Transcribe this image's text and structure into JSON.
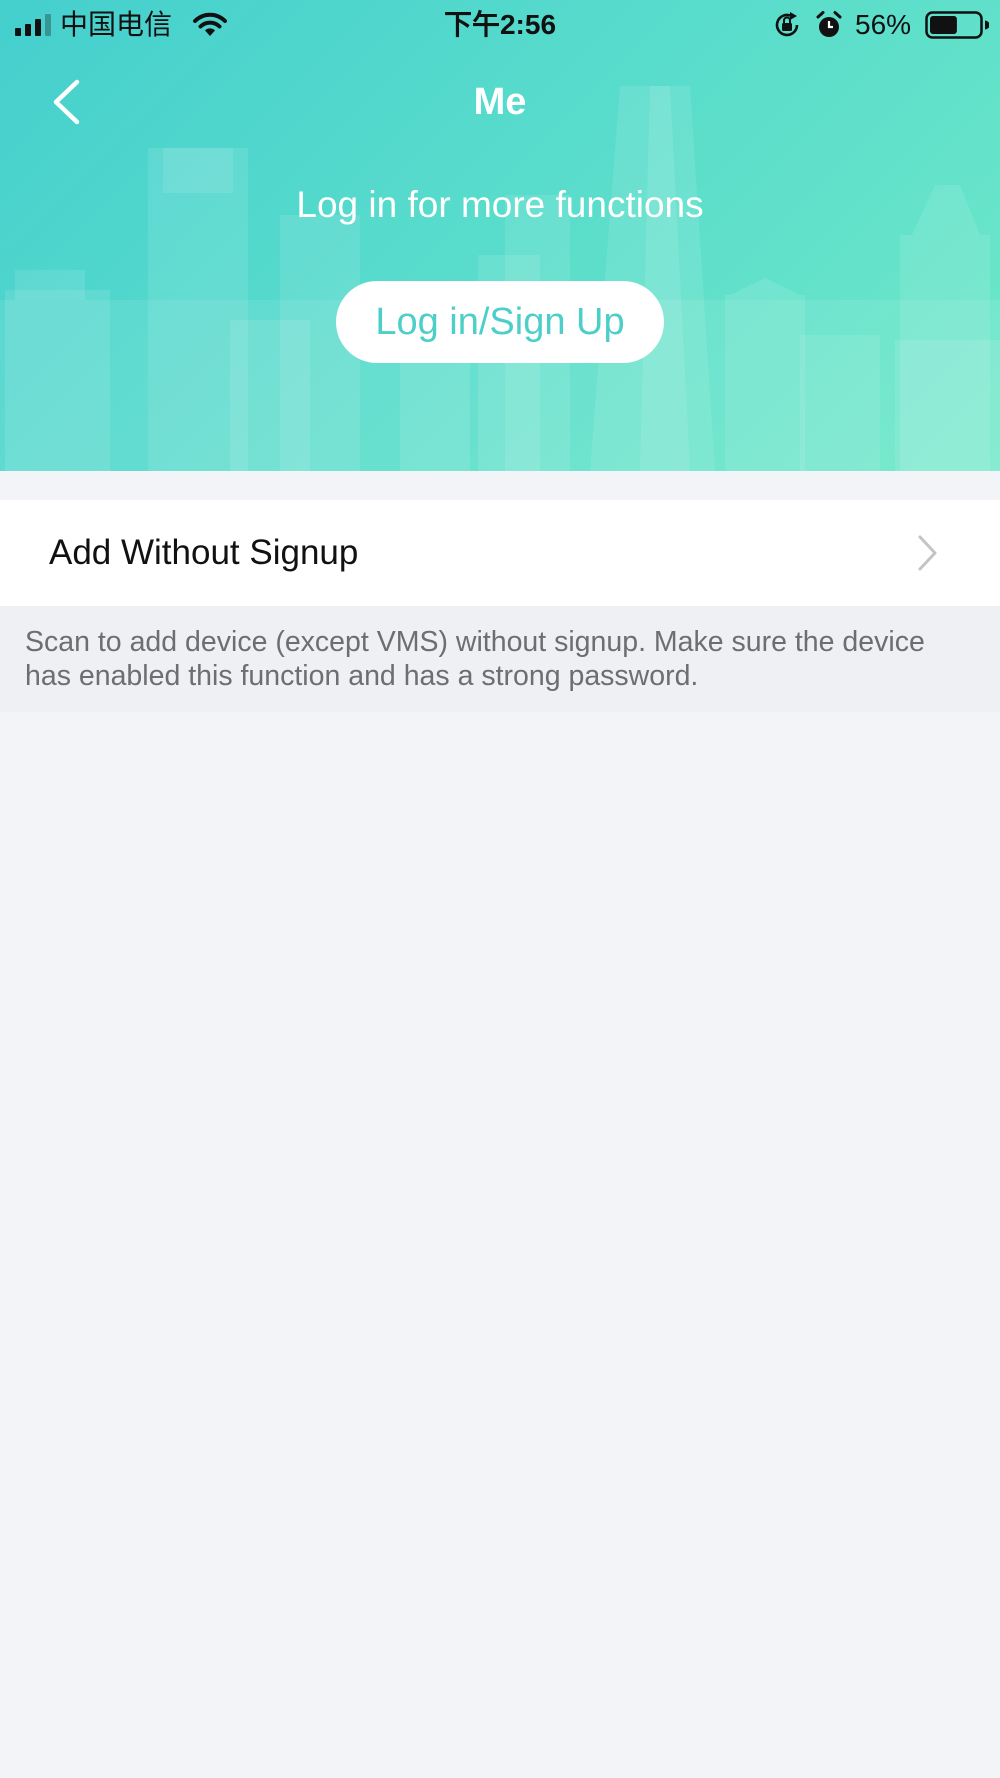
{
  "status_bar": {
    "carrier": "中国电信",
    "time": "下午2:56",
    "battery_percent": "56%",
    "battery_level": 0.56,
    "icons": [
      "signal-icon",
      "wifi-icon",
      "orientation-lock-icon",
      "alarm-icon",
      "battery-icon"
    ]
  },
  "header": {
    "back_icon": "chevron-left-icon",
    "title": "Me",
    "subtitle": "Log in for more functions",
    "login_button_label": "Log in/Sign Up"
  },
  "list": {
    "items": [
      {
        "label": "Add Without Signup",
        "icon": "chevron-right-icon"
      }
    ],
    "note": "Scan to add device (except VMS) without signup. Make sure the device has enabled this function and has a strong password."
  },
  "colors": {
    "hero_gradient_start": "#45cfcd",
    "hero_gradient_end": "#6ee8c8",
    "accent": "#4ccfc8",
    "background": "#f3f4f8",
    "note_text": "#6d6d72"
  }
}
